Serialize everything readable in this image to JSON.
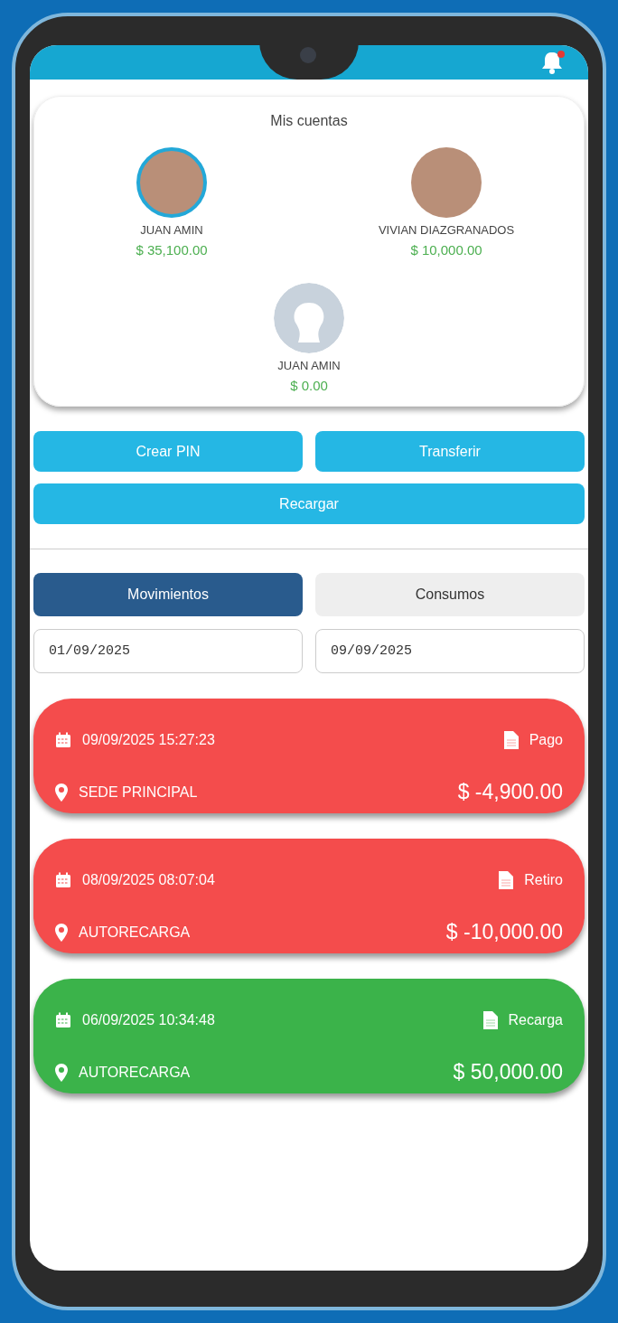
{
  "accounts": {
    "title": "Mis cuentas",
    "items": [
      {
        "kind": "photo",
        "name": "JUAN AMIN",
        "balance": "$ 35,100.00",
        "selected": true
      },
      {
        "kind": "photo",
        "name": "VIVIAN DIAZGRANADOS",
        "balance": "$ 10,000.00",
        "selected": false
      },
      {
        "kind": "default",
        "name": "JUAN AMIN",
        "balance": "$ 0.00",
        "selected": false
      }
    ]
  },
  "actions": [
    "Crear PIN",
    "Transferir",
    "Recargar"
  ],
  "tabs": [
    {
      "label": "Movimientos",
      "selected": true
    },
    {
      "label": "Consumos",
      "selected": false
    }
  ],
  "date_range": {
    "from": "01/09/2025",
    "to": "09/09/2025"
  },
  "transactions": [
    {
      "datetime": "09/09/2025 15:27:23",
      "type": "Pago",
      "location": "SEDE PRINCIPAL",
      "amount": "$ -4,900.00",
      "color": "#f44c4c"
    },
    {
      "datetime": "08/09/2025 08:07:04",
      "type": "Retiro",
      "location": "AUTORECARGA",
      "amount": "$ -10,000.00",
      "color": "#f44c4c"
    },
    {
      "datetime": "06/09/2025 10:34:48",
      "type": "Recarga",
      "location": "AUTORECARGA",
      "amount": "$ 50,000.00",
      "color": "#3bb34a"
    }
  ]
}
